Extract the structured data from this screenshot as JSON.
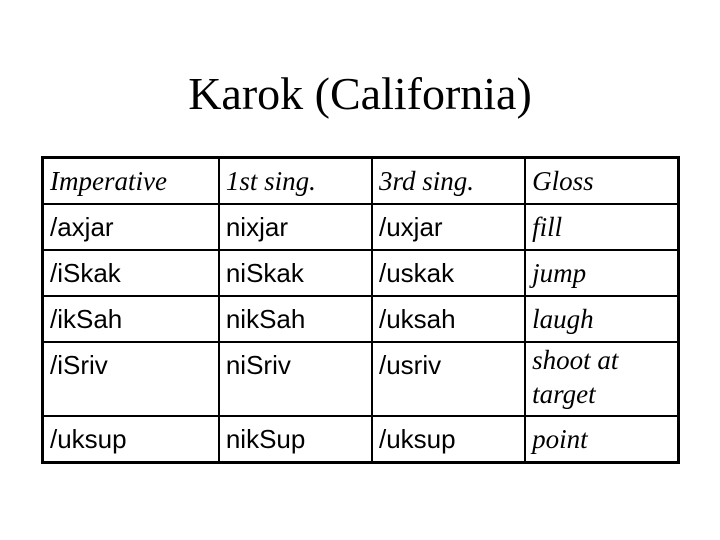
{
  "slide": {
    "title": "Karok (California)"
  },
  "table": {
    "headers": [
      "Imperative",
      "1st sing.",
      "3rd sing.",
      "Gloss"
    ],
    "rows": [
      {
        "imperative": "/axjar",
        "first_sing": "nixjar",
        "third_sing": "/uxjar",
        "gloss": "fill"
      },
      {
        "imperative": "/iSkak",
        "first_sing": "niSkak",
        "third_sing": "/uskak",
        "gloss": "jump"
      },
      {
        "imperative": "/ikSah",
        "first_sing": "nikSah",
        "third_sing": "/uksah",
        "gloss": "laugh"
      },
      {
        "imperative": "/iSriv",
        "first_sing": "niSriv",
        "third_sing": "/usriv",
        "gloss": "shoot at target"
      },
      {
        "imperative": "/uksup",
        "first_sing": "nikSup",
        "third_sing": "/uksup",
        "gloss": "point"
      }
    ]
  }
}
